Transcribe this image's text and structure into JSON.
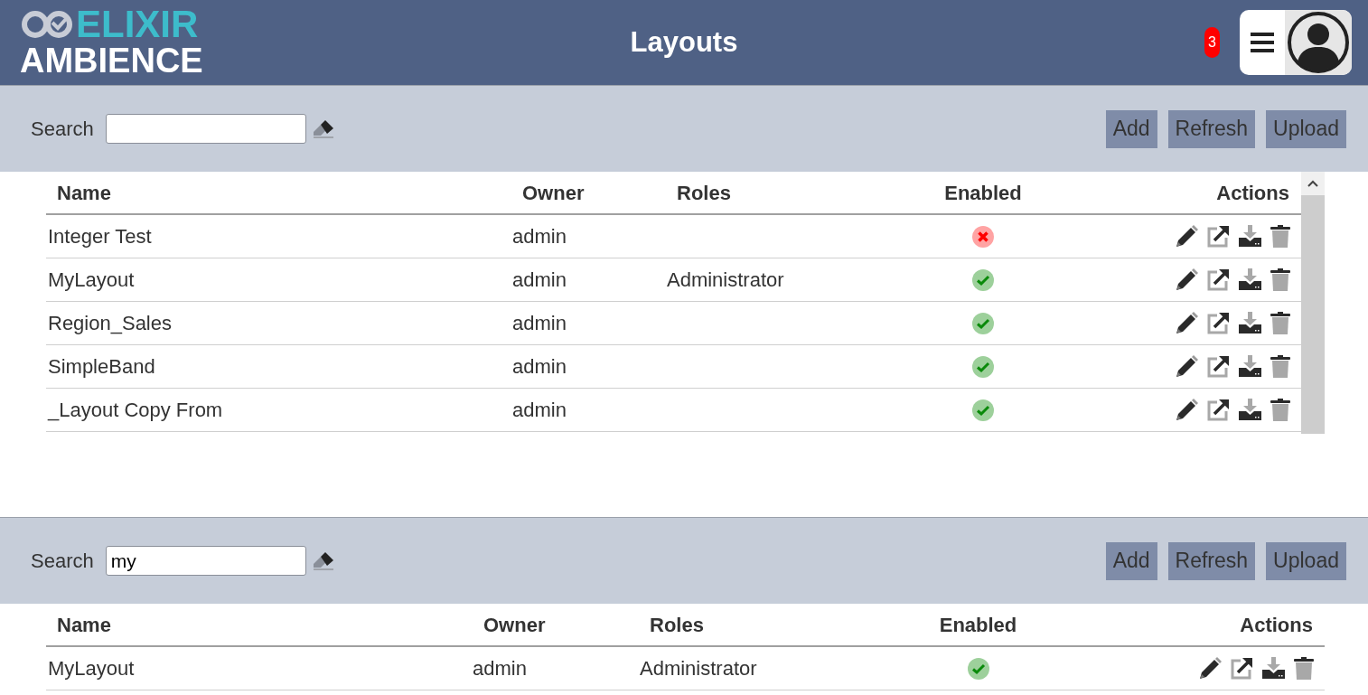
{
  "header": {
    "logo": {
      "line1": "ELIXIR",
      "line2": "AMBIENCE"
    },
    "title": "Layouts",
    "notification_count": "3"
  },
  "panels": [
    {
      "search": {
        "label": "Search"
      },
      "buttons": [
        "Add",
        "Refresh",
        "Upload"
      ],
      "table": {
        "columns": [
          "Name",
          "Owner",
          "Roles",
          "Enabled",
          "Actions"
        ],
        "rows": [
          {
            "name": "Integer Test",
            "owner": "admin",
            "enabled": false
          },
          {
            "name": "MyLayout",
            "owner": "admin",
            "roles": "Administrator",
            "enabled": true
          },
          {
            "name": "Region_Sales",
            "owner": "admin",
            "enabled": true
          },
          {
            "name": "SimpleBand",
            "owner": "admin",
            "enabled": true
          },
          {
            "name": "_Layout Copy From",
            "owner": "admin",
            "enabled": true
          }
        ]
      }
    },
    {
      "search": {
        "label": "Search",
        "value": "my"
      },
      "buttons": [
        "Add",
        "Refresh",
        "Upload"
      ],
      "table": {
        "columns": [
          "Name",
          "Owner",
          "Roles",
          "Enabled",
          "Actions"
        ],
        "rows": [
          {
            "name": "MyLayout",
            "owner": "admin",
            "roles": "Administrator",
            "enabled": true
          }
        ]
      }
    }
  ]
}
